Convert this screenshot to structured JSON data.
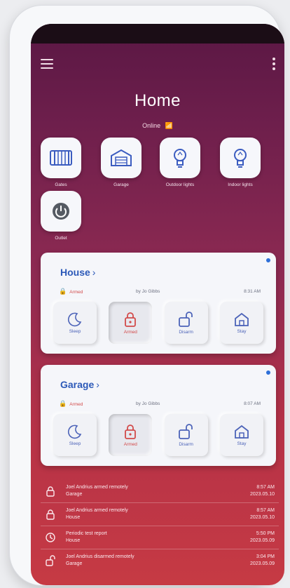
{
  "screen": {
    "title": "Home",
    "status": "Online",
    "signal_glyph": "📶"
  },
  "shortcuts": [
    {
      "label": "Gates",
      "icon": "gate-icon"
    },
    {
      "label": "Garage",
      "icon": "garage-icon"
    },
    {
      "label": "Outdoor lights",
      "icon": "bulb-icon"
    },
    {
      "label": "Indoor lights",
      "icon": "bulb-icon"
    },
    {
      "label": "Outlet",
      "icon": "power-icon"
    }
  ],
  "cards": [
    {
      "name": "House",
      "state": "Armed",
      "by": "by Jo Gibbs",
      "time": "8:31 AM",
      "modes": [
        {
          "label": "Sleep",
          "icon": "moon-icon",
          "active": false
        },
        {
          "label": "Armed",
          "icon": "lock-icon",
          "active": true
        },
        {
          "label": "Disarm",
          "icon": "unlock-icon",
          "active": false
        },
        {
          "label": "Stay",
          "icon": "home-icon",
          "active": false
        }
      ]
    },
    {
      "name": "Garage",
      "state": "Armed",
      "by": "by Jo Gibbs",
      "time": "8:07 AM",
      "modes": [
        {
          "label": "Sleep",
          "icon": "moon-icon",
          "active": false
        },
        {
          "label": "Armed",
          "icon": "lock-icon",
          "active": true
        },
        {
          "label": "Disarm",
          "icon": "unlock-icon",
          "active": false
        },
        {
          "label": "Stay",
          "icon": "home-icon",
          "active": false
        }
      ]
    }
  ],
  "events": [
    {
      "text": "Joel Andrius armed remotely",
      "sub": "Garage",
      "time": "8:57 AM",
      "date": "2023.05.10",
      "icon": "lock-icon"
    },
    {
      "text": "Joel Andrius armed remotely",
      "sub": "House",
      "time": "8:57 AM",
      "date": "2023.05.10",
      "icon": "lock-icon"
    },
    {
      "text": "Periodic test report",
      "sub": "House",
      "time": "5:50 PM",
      "date": "2023.05.09",
      "icon": "clock-icon"
    },
    {
      "text": "Joel Andrius disarmed remotely",
      "sub": "Garage",
      "time": "3:04 PM",
      "date": "2023.05.09",
      "icon": "unlock-icon"
    }
  ],
  "colors": {
    "accent": "#2c59b8",
    "armed": "#d24a4a",
    "bg_top": "#5a1744",
    "bg_bottom": "#c63a44"
  }
}
